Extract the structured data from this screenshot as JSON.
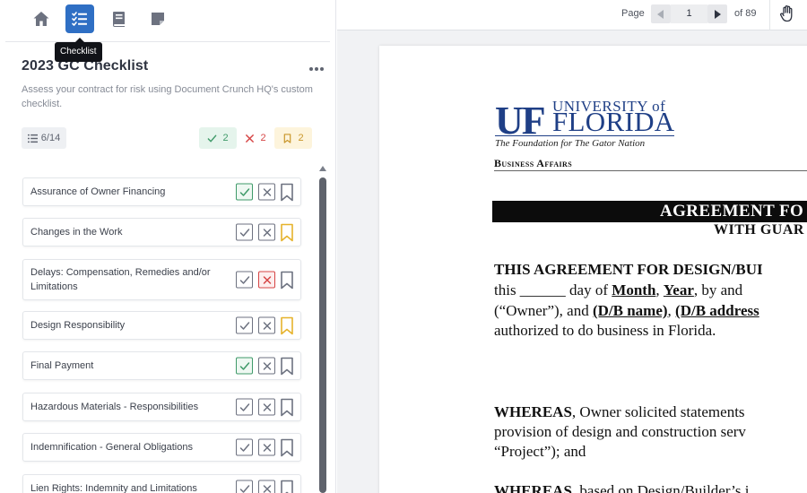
{
  "nav": {
    "tooltip": "Checklist",
    "icons": [
      "home-icon",
      "checklist-icon",
      "book-icon",
      "note-icon"
    ]
  },
  "checklist": {
    "title": "2023 GC Checklist",
    "description": "Assess your contract for risk using Document Crunch HQ's custom checklist.",
    "progress": "6/14",
    "accepted_count": "2",
    "rejected_count": "2",
    "flagged_count": "2",
    "items": [
      {
        "label": "Assurance of Owner Financing",
        "accepted": true,
        "rejected": false,
        "flagged": false
      },
      {
        "label": "Changes in the Work",
        "accepted": false,
        "rejected": false,
        "flagged": true
      },
      {
        "label": "Delays: Compensation, Remedies and/or Limitations",
        "accepted": false,
        "rejected": true,
        "flagged": false
      },
      {
        "label": "Design Responsibility",
        "accepted": false,
        "rejected": false,
        "flagged": true
      },
      {
        "label": "Final Payment",
        "accepted": true,
        "rejected": false,
        "flagged": false
      },
      {
        "label": "Hazardous Materials - Responsibilities",
        "accepted": false,
        "rejected": false,
        "flagged": false
      },
      {
        "label": "Indemnification - General Obligations",
        "accepted": false,
        "rejected": false,
        "flagged": false
      },
      {
        "label": "Lien Rights: Indemnity and Limitations",
        "accepted": false,
        "rejected": false,
        "flagged": false
      }
    ]
  },
  "colors": {
    "accent": "#2f6fc4",
    "accept": "#3f9a69",
    "reject": "#d64545",
    "flag": "#e6b32c"
  },
  "viewer": {
    "page_label": "Page",
    "current_page": "1",
    "page_total": "of 89",
    "tool_icon": "hand-icon"
  },
  "document": {
    "uf_mark": "UF",
    "university_of": "UNIVERSITY of",
    "florida": "FLORIDA",
    "tagline": "The Foundation for The Gator Nation",
    "department": "Business Affairs",
    "banner_title": "AGREEMENT FO",
    "banner_sub": "WITH GUAR",
    "line1": "THIS AGREEMENT FOR DESIGN/BUI",
    "line2_a": "this ______ day of",
    "line2_month": "Month",
    "line2_year": "Year",
    "line2_b": ", by and",
    "line3_a": "(“Owner”), and",
    "line3_dbname": "(D/B name)",
    "line3_dbaddr": "(D/B address",
    "line4": "authorized to do business in Florida.",
    "whereas1_word": "WHEREAS",
    "whereas1_rest": ", Owner solicited statements",
    "line6": "provision of design and construction serv",
    "line7": "“Project”); and",
    "whereas2_word": "WHEREAS",
    "whereas2_rest": ", based on Design/Builder’s i"
  }
}
